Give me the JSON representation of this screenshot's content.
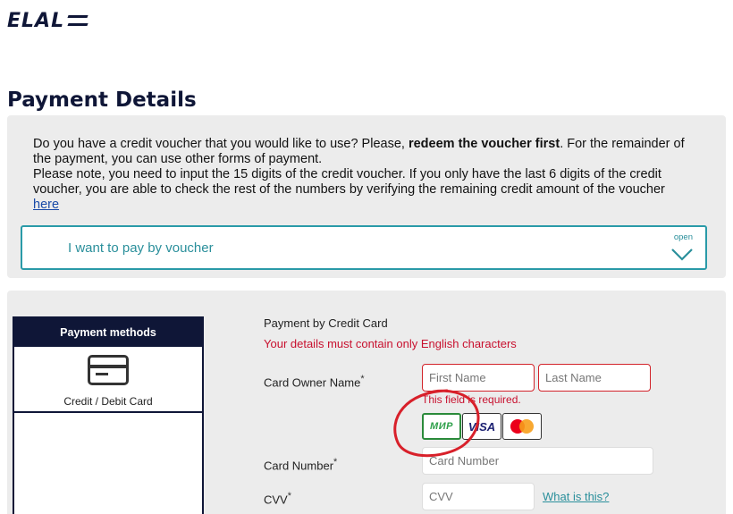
{
  "header": {
    "logo_text": "ELAL",
    "logo_label": "EL AL"
  },
  "page_title": "Payment Details",
  "voucher": {
    "line1_pre": "Do you have a credit voucher that you would like to use? Please, ",
    "line1_bold": "redeem the voucher first",
    "line1_post": ". For the remainder of the payment, you can use other forms of payment.",
    "line2": "Please note, you need to input the 15 digits of the credit voucher. If you only have the last 6 digits of the credit voucher, you are able to check the rest of the numbers by verifying the remaining credit amount of the voucher",
    "here_link": "here",
    "toggle_label": "I want to pay by voucher",
    "toggle_state": "open"
  },
  "payment_methods": {
    "header": "Payment methods",
    "items": [
      {
        "label": "Credit / Debit Card",
        "icon": "credit-card-icon"
      }
    ]
  },
  "credit_card_form": {
    "title": "Payment by Credit Card",
    "warning": "Your details must contain only English characters",
    "owner_label": "Card Owner Name",
    "required_marker": "*",
    "first_name_placeholder": "First Name",
    "last_name_placeholder": "Last Name",
    "error_required": "This field is required.",
    "brands": [
      "МИР",
      "VISA",
      "mastercard"
    ],
    "card_number_label": "Card Number",
    "card_number_placeholder": "Card Number",
    "cvv_label": "CVV",
    "cvv_placeholder": "CVV",
    "what_is_this": "What is this?"
  },
  "colors": {
    "brand_navy": "#0f1637",
    "teal": "#2a9aa8",
    "error_red": "#c8102e",
    "annotation_red": "#d8202a"
  }
}
